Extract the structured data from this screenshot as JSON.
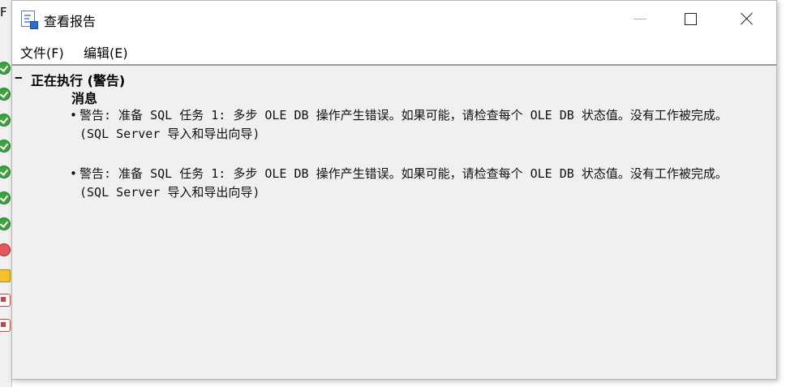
{
  "background": {
    "title_fragment": "F",
    "status_icons": [
      "ok",
      "ok",
      "ok",
      "ok",
      "ok",
      "ok",
      "ok",
      "err",
      "warn",
      "stop",
      "stop"
    ]
  },
  "window": {
    "title": "查看报告",
    "menu": {
      "file": "文件(F)",
      "edit": "编辑(E)"
    }
  },
  "report": {
    "collapse_symbol": "−",
    "section_title": "正在执行 (警告)",
    "subheading": "消息",
    "bullet": "•",
    "messages": [
      "警告: 准备 SQL 任务 1: 多步 OLE DB 操作产生错误。如果可能，请检查每个 OLE DB 状态值。没有工作被完成。 (SQL Server 导入和导出向导)",
      "警告: 准备 SQL 任务 1: 多步 OLE DB 操作产生错误。如果可能，请检查每个 OLE DB 状态值。没有工作被完成。 (SQL Server 导入和导出向导)"
    ]
  },
  "colors": {
    "content_bg": "#f0f0f0",
    "window_bg": "#ffffff",
    "ok_icon": "#3ea33e",
    "error_icon": "#e05a5a",
    "warning_icon": "#f2c230"
  }
}
